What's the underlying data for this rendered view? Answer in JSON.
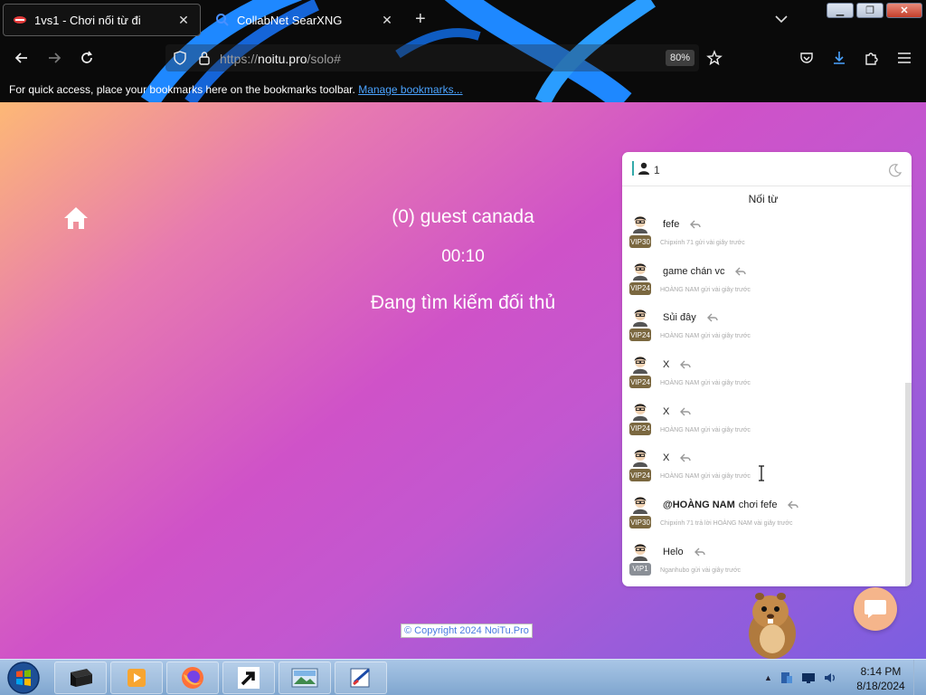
{
  "browser": {
    "tabs": [
      {
        "title": "1vs1 - Chơi nối từ đi",
        "active": true
      },
      {
        "title": "CollabNet SearXNG",
        "active": false
      }
    ],
    "url_prefix": "https://",
    "url_host": "noitu.pro",
    "url_path": "/solo#",
    "zoom": "80%",
    "bookmarks_text": "For quick access, place your bookmarks here on the bookmarks toolbar.",
    "bookmarks_link": "Manage bookmarks..."
  },
  "game": {
    "player": "(0) guest canada",
    "timer": "00:10",
    "status": "Đang tìm kiếm đối thủ",
    "copyright": "© Copyright 2024 NoiTu.Pro"
  },
  "chat": {
    "online_count": "1",
    "title": "Nối từ",
    "messages": [
      {
        "badge": "VIP30",
        "mention": "",
        "text": "fefe",
        "meta": "Chipxinh 71 gửi vài giây trước"
      },
      {
        "badge": "VIP24",
        "mention": "",
        "text": "game chán vc",
        "meta": "HOÀNG NAM gửi vài giây trước"
      },
      {
        "badge": "VIP24",
        "mention": "",
        "text": "Sủi đây",
        "meta": "HOÀNG NAM gửi vài giây trước"
      },
      {
        "badge": "VIP24",
        "mention": "",
        "text": "X",
        "meta": "HOÀNG NAM gửi vài giây trước"
      },
      {
        "badge": "VIP24",
        "mention": "",
        "text": "X",
        "meta": "HOÀNG NAM gửi vài giây trước"
      },
      {
        "badge": "VIP24",
        "mention": "",
        "text": "X",
        "meta": "HOÀNG NAM gửi vài giây trước"
      },
      {
        "badge": "VIP30",
        "mention": "@HOÀNG NAM",
        "text": "chơi fefe",
        "meta": "Chipxinh 71 trả lời HOÀNG NAM vài giây trước"
      },
      {
        "badge": "VIP1",
        "mention": "",
        "text": "Helo",
        "meta": "Nganhubo gửi vài giây trước"
      }
    ]
  },
  "taskbar": {
    "time": "8:14 PM",
    "date": "8/18/2024"
  },
  "colors": {
    "vip_badge": "#7b6840",
    "vip1_badge": "#8a8f96",
    "chat_fab": "#f5b58b"
  }
}
